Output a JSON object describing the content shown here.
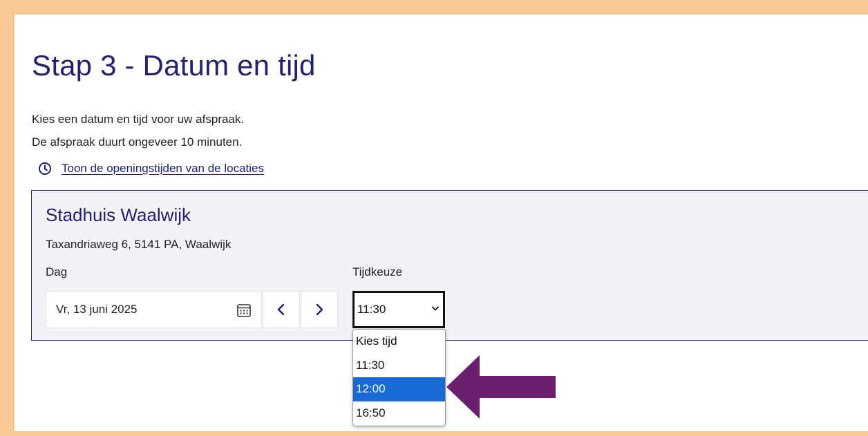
{
  "page": {
    "title": "Stap 3 - Datum en tijd",
    "intro_line1": "Kies een datum en tijd voor uw afspraak.",
    "intro_line2": "De afspraak duurt ongeveer 10 minuten.",
    "hours_link": "Toon de openingstijden van de locaties"
  },
  "location": {
    "name": "Stadhuis Waalwijk",
    "address": "Taxandriaweg 6, 5141 PA, Waalwijk",
    "day_label": "Dag",
    "time_label": "Tijdkeuze",
    "date_value": "Vr, 13 juni 2025",
    "time_value": "11:30"
  },
  "dropdown": {
    "options": [
      "Kies tijd",
      "11:30",
      "12:00",
      "16:50"
    ],
    "highlighted": "12:00"
  },
  "colors": {
    "frame": "#f6c894",
    "heading": "#24216f",
    "highlight": "#1a6ad6",
    "arrow": "#6b1f6f"
  },
  "icons": [
    "clock-icon",
    "calendar-icon",
    "chevron-left-icon",
    "chevron-right-icon",
    "chevron-down-icon",
    "arrow-left-icon"
  ]
}
